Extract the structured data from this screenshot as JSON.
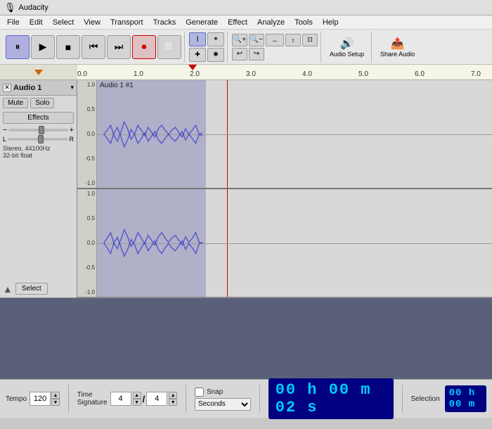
{
  "titleBar": {
    "icon": "🎙",
    "title": "Audacity"
  },
  "menuBar": {
    "items": [
      "File",
      "Edit",
      "Select",
      "View",
      "Transport",
      "Tracks",
      "Generate",
      "Effect",
      "Analyze",
      "Tools",
      "Help"
    ]
  },
  "toolbar": {
    "transport": {
      "pause": "⏸",
      "play": "▶",
      "stop": "■",
      "rewind": "⏮",
      "forward": "⏭",
      "record": "⏺"
    },
    "tools": {
      "select": "I",
      "envelope": "✱",
      "multi": "✦",
      "star": "✱"
    },
    "zoom": {
      "zoomIn": "+",
      "zoomOut": "−",
      "fit": "↔",
      "fitV": "↕",
      "zoomSel": "⊡",
      "undo": "↩",
      "redo": "↪"
    },
    "audioSetup": "Audio Setup",
    "shareAudio": "Share Audio"
  },
  "ruler": {
    "markers": [
      "0.0",
      "1.0",
      "2.0",
      "3.0",
      "4.0",
      "5.0",
      "6.0",
      "7.0"
    ]
  },
  "track": {
    "name": "Audio 1",
    "dropdownArrow": "▾",
    "closeBtn": "✕",
    "muteLabel": "Mute",
    "soloLabel": "Solo",
    "effectsLabel": "Effects",
    "gainMinus": "−",
    "gainPlus": "+",
    "panL": "L",
    "panR": "R",
    "format": "Stereo, 44100Hz",
    "bitDepth": "32-bit float",
    "selectLabel": "Select",
    "clipLabel": "Audio 1 #1"
  },
  "statusBar": {
    "tempoLabel": "Tempo",
    "tempoValue": "120",
    "timeSigLabel": "Time Signature",
    "timeSigNum": "4",
    "timeSigDen": "4",
    "snapLabel": "Snap",
    "snapChecked": false,
    "secondsLabel": "Seconds",
    "timeDisplay": "00 h 00 m 02 s",
    "selectionLabel": "Selection",
    "selectionDisplay": "00 h 00 m"
  }
}
